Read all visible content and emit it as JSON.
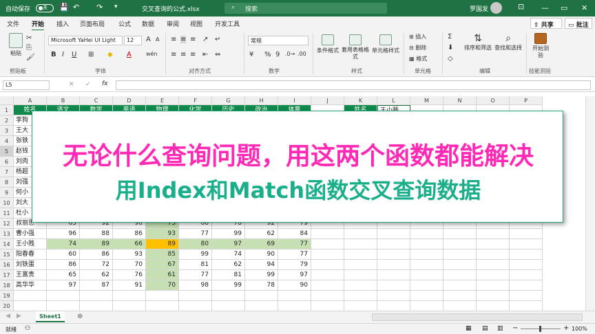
{
  "titlebar": {
    "autosave": "自动保存",
    "autosave_state": "关",
    "filename": "交叉查询的公式.xlsx",
    "search_placeholder": "搜索",
    "user": "罗国发",
    "minimize": "—",
    "restore": "▭",
    "close": "✕"
  },
  "menu": {
    "tabs": [
      "文件",
      "开始",
      "插入",
      "页面布局",
      "公式",
      "数据",
      "审阅",
      "视图",
      "开发工具"
    ],
    "active": "开始",
    "share": "共享",
    "comment": "批注"
  },
  "ribbon": {
    "paste": "粘贴",
    "clipboard": "剪贴板",
    "font_name": "Microsoft YaHei UI Light",
    "font_size": "12",
    "font": "字体",
    "alignment": "对齐方式",
    "number_format": "常规",
    "number": "数字",
    "conditional_format": "条件格式",
    "format_as_table": "套用表格格式",
    "cell_styles": "单元格样式",
    "styles": "样式",
    "insert": "插入",
    "delete": "删除",
    "format": "格式",
    "cells": "单元格",
    "sort_filter": "排序和筛选",
    "find_select": "查找和选择",
    "editing": "编辑",
    "dev_test": "开始测验",
    "dev_group": "技能测验",
    "bold": "B",
    "italic": "I",
    "underline": "U",
    "percent": "%",
    "comma": "9"
  },
  "formula_bar": {
    "name_box": "L5",
    "fx": "fx",
    "cancel": "✕",
    "enter": "✓"
  },
  "grid": {
    "columns": [
      "A",
      "B",
      "C",
      "D",
      "E",
      "F",
      "G",
      "H",
      "I",
      "J",
      "K",
      "L",
      "M",
      "N",
      "O",
      "P"
    ],
    "rows": [
      "1",
      "2",
      "3",
      "4",
      "5",
      "6",
      "7",
      "8",
      "9",
      "10",
      "11",
      "12",
      "13",
      "14",
      "15",
      "16",
      "17",
      "18",
      "19",
      "20",
      "21"
    ],
    "headers": [
      "姓名",
      "语文",
      "数学",
      "英语",
      "物理",
      "化学",
      "历史",
      "政治",
      "体育"
    ],
    "lookup_label": "姓名",
    "lookup_value": "王小贱",
    "names_partial": [
      "李狗",
      "王大",
      "张铁",
      "赵钱",
      "刘肉",
      "杨超",
      "刘强",
      "何小",
      "刘大",
      "杜小"
    ],
    "data": [
      {
        "name": "叔丽思",
        "scores": [
          "65",
          "92",
          "90",
          "73",
          "66",
          "78",
          "92",
          "79"
        ]
      },
      {
        "name": "曹小强",
        "scores": [
          "96",
          "88",
          "86",
          "93",
          "77",
          "99",
          "62",
          "84"
        ]
      },
      {
        "name": "王小贱",
        "scores": [
          "74",
          "89",
          "66",
          "89",
          "80",
          "97",
          "69",
          "77"
        ]
      },
      {
        "name": "阳春春",
        "scores": [
          "60",
          "86",
          "93",
          "85",
          "99",
          "74",
          "90",
          "77"
        ]
      },
      {
        "name": "刘铁蛋",
        "scores": [
          "86",
          "72",
          "70",
          "67",
          "81",
          "62",
          "94",
          "79"
        ]
      },
      {
        "name": "王富贵",
        "scores": [
          "65",
          "62",
          "76",
          "61",
          "77",
          "81",
          "99",
          "97"
        ]
      },
      {
        "name": "高华华",
        "scores": [
          "97",
          "87",
          "91",
          "70",
          "98",
          "99",
          "78",
          "90"
        ]
      }
    ]
  },
  "sheet": {
    "tab": "Sheet1",
    "add": "⊕"
  },
  "status": {
    "ready": "就绪",
    "zoom": "100%"
  },
  "overlay": {
    "line1": "无论什么查询问题，用这两个函数都能解决",
    "line2": "用Index和Match函数交叉查询数据"
  },
  "colors": {
    "excel_green": "#1f7244",
    "header_fill": "#0f8a4b",
    "physics_fill": "#c6e0b4",
    "highlight": "#ffc000",
    "line1": "#ff29b5",
    "line2": "#1aae8a"
  }
}
